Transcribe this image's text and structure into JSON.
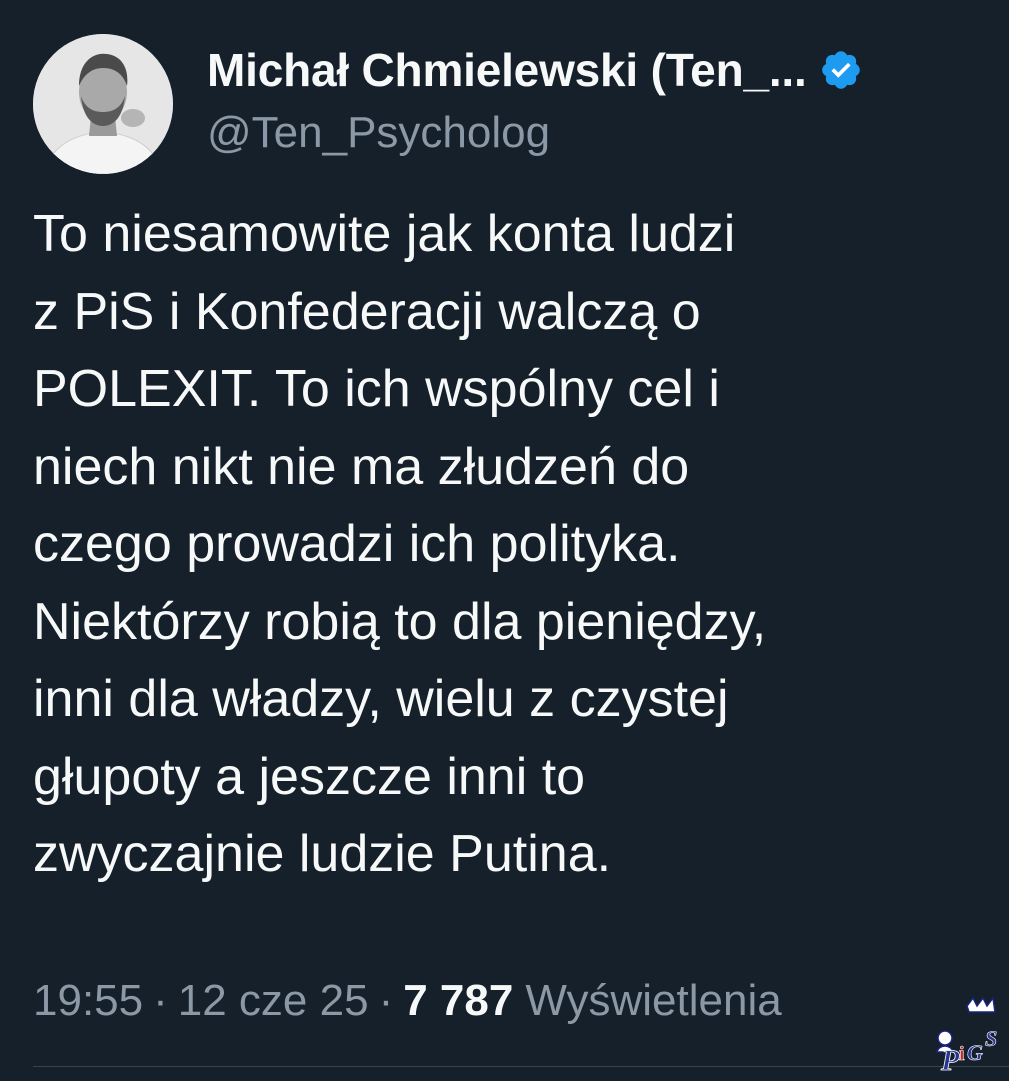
{
  "author": {
    "display_name": "Michał Chmielewski (Ten_...",
    "handle": "@Ten_Psycholog",
    "verified_icon": "verified-badge-icon",
    "avatar_icon": "profile-photo"
  },
  "tweet": {
    "lines": [
      "To niesamowite jak konta ludzi",
      "z PiS i Konfederacji walczą o",
      "POLEXIT. To ich wspólny cel i",
      "niech nikt nie ma złudzeń do",
      "czego prowadzi ich polityka.",
      "Niektórzy robią to dla pieniędzy,",
      "inni dla władzy, wielu z czystej",
      "głupoty a jeszcze inni to",
      "zwyczajnie ludzie Putina."
    ]
  },
  "meta": {
    "time": "19:55",
    "separator": "·",
    "date": "12 cze 25",
    "views_count": "7 787",
    "views_label": "Wyświetlenia"
  },
  "watermark": {
    "text": "PiGS"
  },
  "colors": {
    "background": "#15202b",
    "text": "#f7f9f9",
    "secondary": "#8b98a5",
    "verified": "#1d9bf0"
  }
}
